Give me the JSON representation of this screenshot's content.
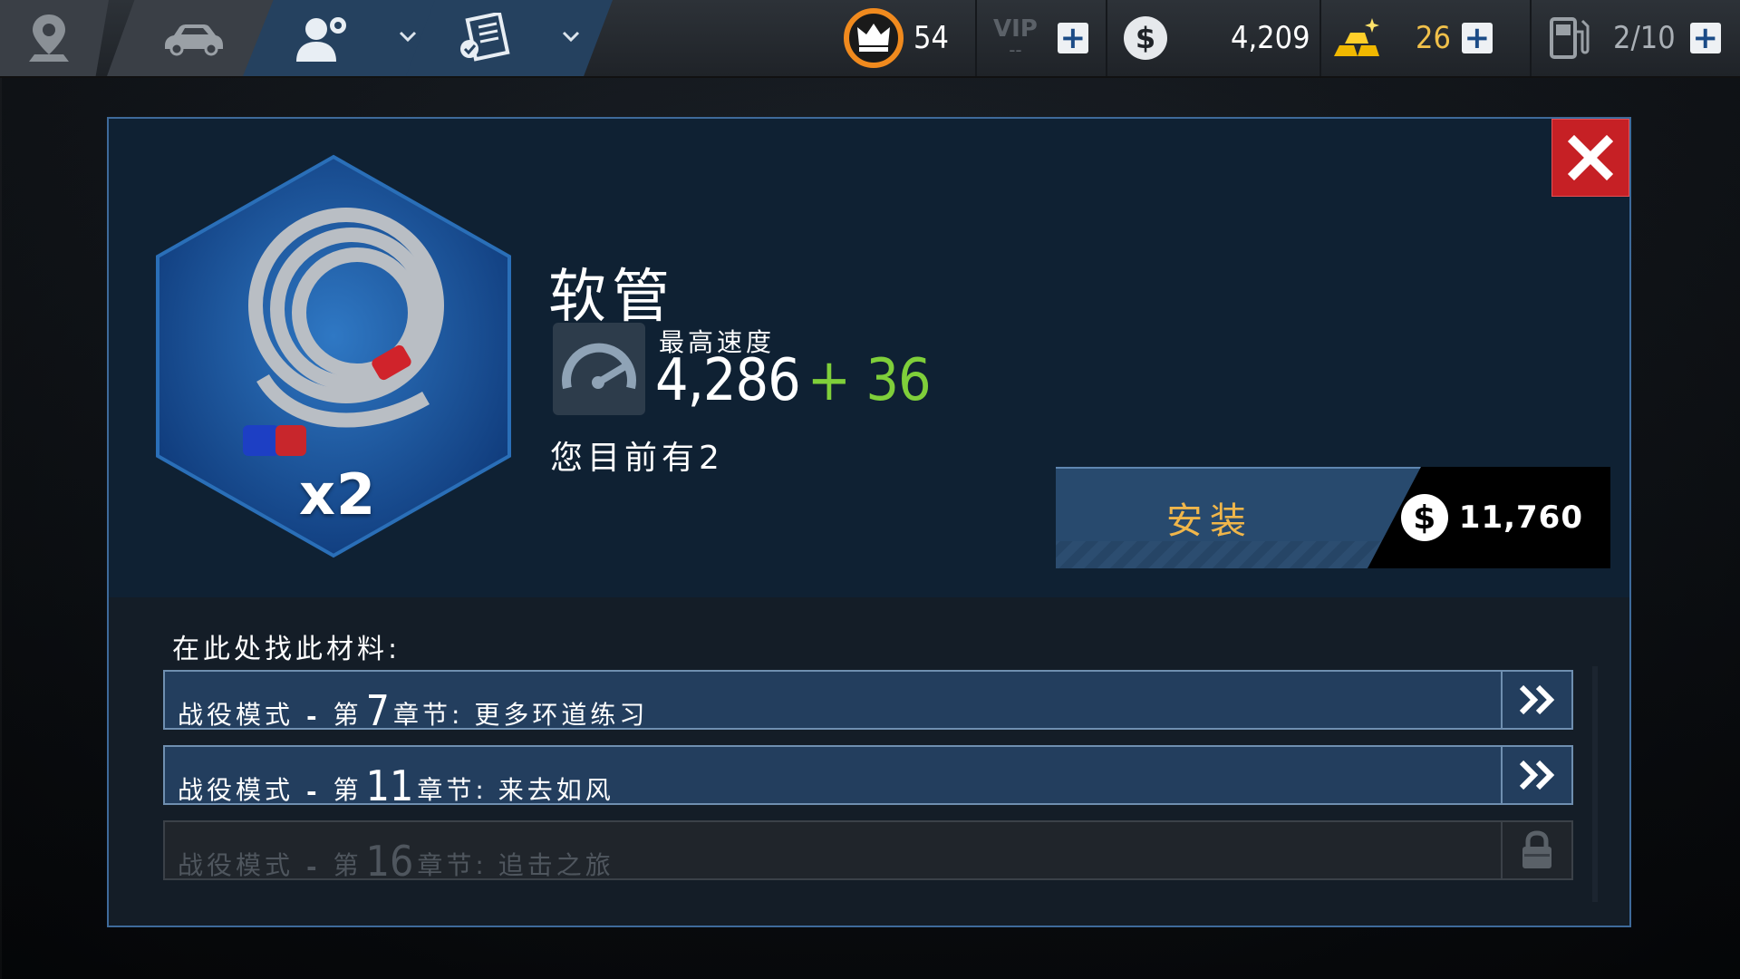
{
  "topbar": {
    "tabs": [
      {
        "name": "map",
        "icon": "map-pin-icon"
      },
      {
        "name": "garage",
        "icon": "car-icon"
      },
      {
        "name": "driver",
        "icon": "driver-gear-icon"
      },
      {
        "name": "tasks",
        "icon": "checklist-icon"
      }
    ],
    "crown_value": "54",
    "vip_label": "VIP",
    "vip_value": "--",
    "cash_value": "4,209",
    "gold_value": "26",
    "fuel_value": "2/10",
    "colors": {
      "active_tab": "#25415f",
      "gold_text": "#f0c04a",
      "crown_ring": "#f08a1e"
    }
  },
  "modal": {
    "part_name": "软管",
    "part_count": "x2",
    "stat_label": "最高速度",
    "stat_value": "4,286",
    "stat_bonus": "+ 36",
    "owned_text": "您目前有2",
    "install_label": "安装",
    "install_price": "11,760",
    "find_label": "在此处找此材料:",
    "sources": [
      {
        "prefix": "战役模式",
        "dash": "-",
        "pre": "第",
        "num": "7",
        "post": "章节:",
        "name": "更多环道练习",
        "locked": false
      },
      {
        "prefix": "战役模式",
        "dash": "-",
        "pre": "第",
        "num": "11",
        "post": "章节:",
        "name": "来去如风",
        "locked": false
      },
      {
        "prefix": "战役模式",
        "dash": "-",
        "pre": "第",
        "num": "16",
        "post": "章节:",
        "name": "追击之旅",
        "locked": true
      }
    ],
    "colors": {
      "close_button": "#c62025",
      "bonus": "#7fcf3a",
      "install_text": "#f0b64a"
    }
  }
}
